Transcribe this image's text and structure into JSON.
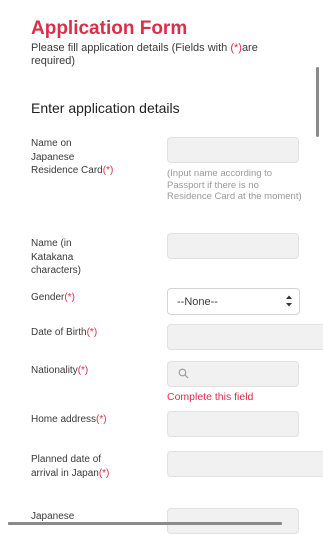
{
  "header": {
    "title": "Application Form",
    "subtitle_pre": "Please fill application details (Fields with ",
    "required_marker": "(*)",
    "subtitle_post": "are required)"
  },
  "section": {
    "title": "Enter application details"
  },
  "fields": {
    "residence_name": {
      "label": "Name on Japanese Residence Card",
      "required": "(*)",
      "value": "",
      "help": "(Input name according to Passport if there is no Residence Card at the moment)"
    },
    "katakana_name": {
      "label": "Name (in Katakana characters)",
      "value": ""
    },
    "gender": {
      "label": "Gender",
      "required": "(*)",
      "selected": "--None--"
    },
    "dob": {
      "label": "Date of Birth",
      "required": "(*)",
      "value": ""
    },
    "nationality": {
      "label": "Nationality",
      "required": "(*)",
      "value": "",
      "error": "Complete this field"
    },
    "home_address": {
      "label": "Home address",
      "required": "(*)",
      "value": ""
    },
    "arrival_date": {
      "label": "Planned date of arrival in Japan",
      "required": "(*)",
      "value": ""
    },
    "japanese": {
      "label": "Japanese"
    }
  },
  "colors": {
    "accent": "#dc2d4a",
    "input_bg": "#f1f1f1"
  },
  "icons": {
    "nationality_search": "search-icon",
    "gender_select": "updown-arrows-icon"
  }
}
